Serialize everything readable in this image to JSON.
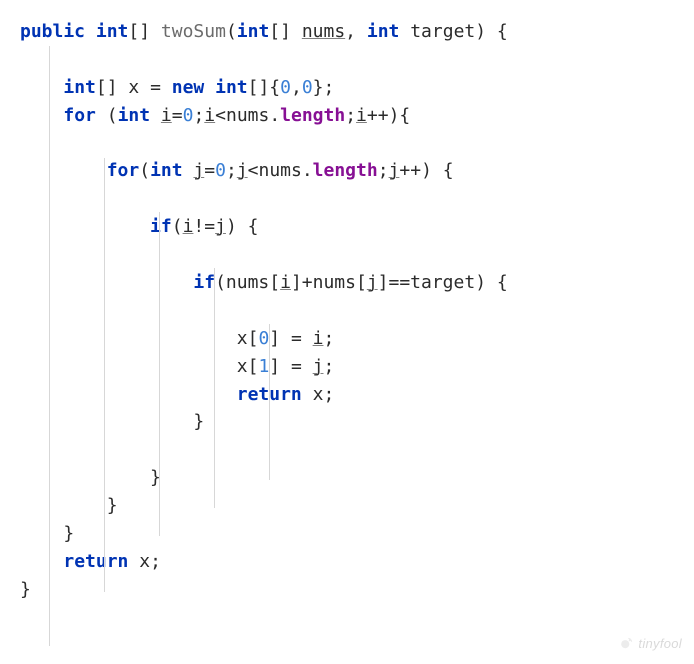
{
  "code": {
    "l1": {
      "kw_public": "public",
      "kw_int": "int",
      "br1": "[] ",
      "method": "twoSum",
      "p1": "(",
      "kw_int2": "int",
      "br2": "[] ",
      "param1": "nums",
      "comma": ", ",
      "kw_int3": "int",
      "sp": " ",
      "param2": "target",
      "p2": ") {"
    },
    "l2": {
      "kw_int": "int",
      "br": "[] ",
      "x": "x",
      "eq": " = ",
      "kw_new": "new",
      "sp": " ",
      "kw_int2": "int",
      "br2": "[]{",
      "n0": "0",
      "c": ",",
      "n1": "0",
      "end": "};"
    },
    "l3": {
      "kw_for": "for",
      "p": " (",
      "kw_int": "int",
      "sp": " ",
      "i": "i",
      "eq": "=",
      "n0": "0",
      "sc": ";",
      "i2": "i",
      "lt": "<nums.",
      "len": "length",
      "sc2": ";",
      "i3": "i",
      "pp": "++){"
    },
    "l4": {
      "kw_for": "for",
      "p": "(",
      "kw_int": "int",
      "sp": " ",
      "j": "j",
      "eq": "=",
      "n0": "0",
      "sc": ";",
      "j2": "j",
      "lt": "<nums.",
      "len": "length",
      "sc2": ";",
      "j3": "j",
      "pp": "++) {"
    },
    "l5": {
      "kw_if": "if",
      "p": "(",
      "i": "i",
      "ne": "!=",
      "j": "j",
      "end": ") {"
    },
    "l6": {
      "kw_if": "if",
      "p": "(nums[",
      "i": "i",
      "mid": "]+nums[",
      "j": "j",
      "end": "]==target) {"
    },
    "l7": {
      "x": "x[",
      "n": "0",
      "br": "] = ",
      "i": "i",
      "sc": ";"
    },
    "l8": {
      "x": "x[",
      "n": "1",
      "br": "] = ",
      "j": "j",
      "sc": ";"
    },
    "l9": {
      "kw_return": "return",
      "sp": " x;"
    },
    "close1": "}",
    "close2": "}",
    "close3": "}",
    "close4": "}",
    "l10": {
      "kw_return": "return",
      "sp": " x;"
    },
    "close5": "}"
  },
  "watermark": "tinyfool"
}
